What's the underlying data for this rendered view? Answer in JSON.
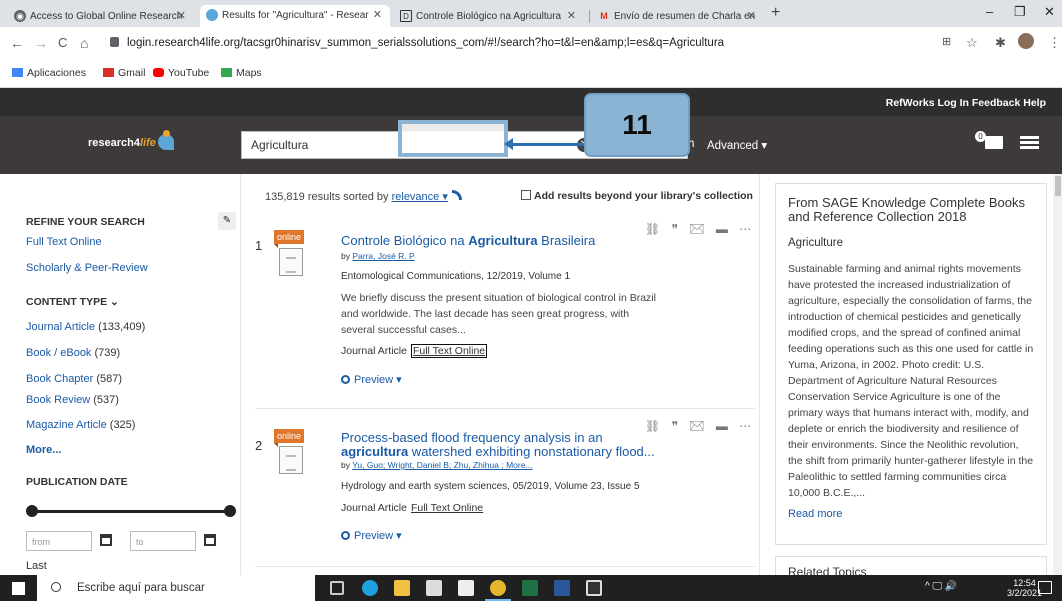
{
  "browser": {
    "tabs": [
      {
        "title": "Access to Global Online Research",
        "icon_color": "#5f6368"
      },
      {
        "title": "Results for \"Agricultura\" - Resear",
        "icon_color": "#5aa7d8"
      },
      {
        "title": "Controle Biológico na Agricultura",
        "icon_color": "#333"
      },
      {
        "title": "Envío de resumen de Charla en",
        "icon_color": "#d93025"
      }
    ],
    "new_tab": "+",
    "window_controls": [
      "–",
      "❐",
      "✕"
    ],
    "url": "login.research4life.org/tacsgr0hinarisv_summon_serialssolutions_com/#!/search?ho=t&l=en&amp;l=es&q=Agricultura",
    "nav": {
      "back": "←",
      "forward": "→",
      "reload": "C",
      "home": "⌂"
    },
    "bookmarks": [
      {
        "label": "Aplicaciones",
        "color": "#4285f4"
      },
      {
        "label": "Gmail",
        "color": "#d93025"
      },
      {
        "label": "YouTube",
        "color": "#ff0000"
      },
      {
        "label": "Maps",
        "color": "#34a853"
      }
    ]
  },
  "site": {
    "top_links": "RefWorks Log In  Feedback  Help",
    "logo_text": "research4",
    "logo_life": "life",
    "search_value": "Agricultura",
    "search_label": "h",
    "advanced_label": "Advanced ▾",
    "folder_count": "0"
  },
  "annotation": {
    "number": "11"
  },
  "sidebar": {
    "refine_title": "REFINE YOUR SEARCH",
    "filters": [
      "Full Text Online",
      "Scholarly & Peer-Review"
    ],
    "content_type_title": "CONTENT TYPE ⌄",
    "content_types": [
      {
        "label": "Journal Article",
        "count": "(133,409)"
      },
      {
        "label": "Book / eBook",
        "count": "(739)"
      },
      {
        "label": "Book Chapter",
        "count": "(587)"
      },
      {
        "label": "Book Review",
        "count": "(537)"
      },
      {
        "label": "Magazine Article",
        "count": "(325)"
      }
    ],
    "more_label": "More...",
    "pub_date_title": "PUBLICATION DATE",
    "from_placeholder": "from",
    "to_placeholder": "to",
    "last_label": "Last"
  },
  "results": {
    "count_text": "135,819 results sorted by",
    "sort_label": "relevance ▾",
    "add_beyond": "Add results beyond your library's collection",
    "items": [
      {
        "num": "1",
        "badge": "online",
        "title_pre": "Controle Biológico na ",
        "title_bold": "Agricultura",
        "title_post": " Brasileira",
        "by": "by",
        "authors": "Parra, José R. P",
        "source": "Entomological Communications, 12/2019, Volume 1",
        "abstract": "We briefly discuss the present situation of biological control in Brazil and worldwide. The last decade has seen great progress, with several successful cases...",
        "type": "Journal Article",
        "fulltext": "Full Text Online",
        "preview": "Preview ▾"
      },
      {
        "num": "2",
        "badge": "online",
        "title_pre": "Process-based flood frequency analysis in an ",
        "title_bold": "agricultura",
        "title_post": " watershed exhibiting nonstationary flood...",
        "by": "by",
        "authors": "Yu, Guo; Wright, Daniel B; Zhu, Zhihua ; More...",
        "source": "Hydrology and earth system sciences, 05/2019, Volume 23, Issue 5",
        "type": "Journal Article",
        "fulltext": "Full Text Online",
        "preview": "Preview ▾"
      }
    ],
    "actions": "⛓ ❞ ✉ ▬ ⋯"
  },
  "right_panel": {
    "title": "From SAGE Knowledge Complete Books and Reference Collection 2018",
    "subject": "Agriculture",
    "text": "Sustainable farming and animal rights movements have protested the increased industrialization of agriculture, especially the consolidation of farms, the introduction of chemical pesticides and genetically modified crops, and the spread of confined animal feeding operations such as this one used for cattle in Yuma, Arizona, in 2002. Photo credit: U.S. Department of Agriculture Natural Resources Conservation Service Agriculture is one of the primary ways that humans interact with, modify, and deplete or enrich the biodiversity and resilience of their environments. Since the Neolithic revolution, the shift from primarily hunter-gatherer lifestyle in the Paleolithic to settled farming communities circa 10,000 B.C.E.,...",
    "read_more": "Read more",
    "related_title": "Related Topics"
  },
  "taskbar": {
    "search_placeholder": "Escribe aquí para buscar",
    "time": "12:54",
    "date": "3/2/2021",
    "tray": "^ 🖵 🔊"
  }
}
